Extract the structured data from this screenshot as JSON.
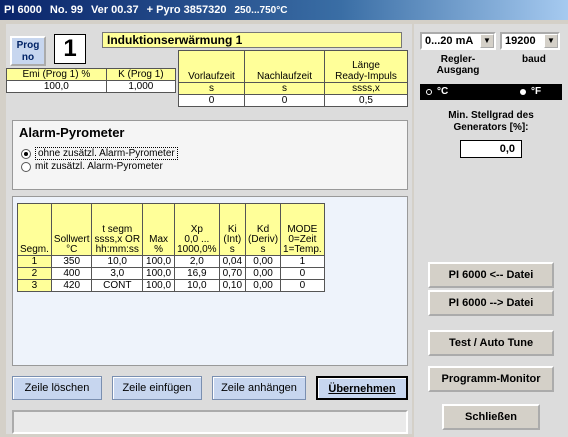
{
  "window": {
    "title_model": "PI 6000",
    "title_no": "No. 99",
    "title_ver": "Ver 00.37",
    "title_pyro": "+ Pyro 3857320",
    "title_range": "250...750°C"
  },
  "program": {
    "button_label_line1": "Prog",
    "button_label_line2": "no",
    "number": "1",
    "name": "Induktionserwärmung 1"
  },
  "params": {
    "emi_label": "Emi (Prog 1) %",
    "emi_value": "100,0",
    "k_label": "K (Prog 1)",
    "k_value": "1,000",
    "vorlauf_label": "Vorlaufzeit",
    "vorlauf_unit": "s",
    "vorlauf_value": "0",
    "nachlauf_label": "Nachlaufzeit",
    "nachlauf_unit": "s",
    "nachlauf_value": "0",
    "laenge_label1": "Länge",
    "laenge_label2": "Ready-Impuls",
    "laenge_unit": "ssss,x",
    "laenge_value": "0,5"
  },
  "alarm": {
    "title": "Alarm-Pyrometer",
    "option1": "ohne zusätzl. Alarm-Pyrometer",
    "option2": "mit zusätzl. Alarm-Pyrometer"
  },
  "segments": {
    "headers": [
      [
        "Segm."
      ],
      [
        "Sollwert",
        "°C"
      ],
      [
        "t segm",
        "ssss,x OR",
        "hh:mm:ss"
      ],
      [
        "Max",
        "%"
      ],
      [
        "Xp",
        "0,0 ...",
        "1000,0%"
      ],
      [
        "Ki",
        "(Int)",
        "s"
      ],
      [
        "Kd",
        "(Deriv)",
        "s"
      ],
      [
        "MODE",
        "0=Zeit",
        "1=Temp."
      ]
    ],
    "rows": [
      [
        "1",
        "350",
        "10,0",
        "100,0",
        "2,0",
        "0,04",
        "0,00",
        "1"
      ],
      [
        "2",
        "400",
        "3,0",
        "100,0",
        "16,9",
        "0,70",
        "0,00",
        "0"
      ],
      [
        "3",
        "420",
        "CONT",
        "100,0",
        "10,0",
        "0,10",
        "0,00",
        "0"
      ]
    ]
  },
  "buttons": {
    "delete_row": "Zeile löschen",
    "insert_row": "Zeile einfügen",
    "append_row": "Zeile anhängen",
    "apply": "Übernehmen"
  },
  "right": {
    "output_select": "0...20 mA",
    "baud_select": "19200",
    "regler_label1": "Regler-",
    "regler_label2": "Ausgang",
    "baud_label": "baud",
    "unit_c": "°C",
    "unit_f": "°F",
    "min_stellgrad_label1": "Min. Stellgrad des",
    "min_stellgrad_label2": "Generators [%]:",
    "min_stellgrad_value": "0,0",
    "file_read": "PI 6000 <-- Datei",
    "file_write": "PI 6000 --> Datei",
    "test_autotune": "Test / Auto Tune",
    "programm_monitor": "Programm-Monitor",
    "close": "Schließen"
  }
}
